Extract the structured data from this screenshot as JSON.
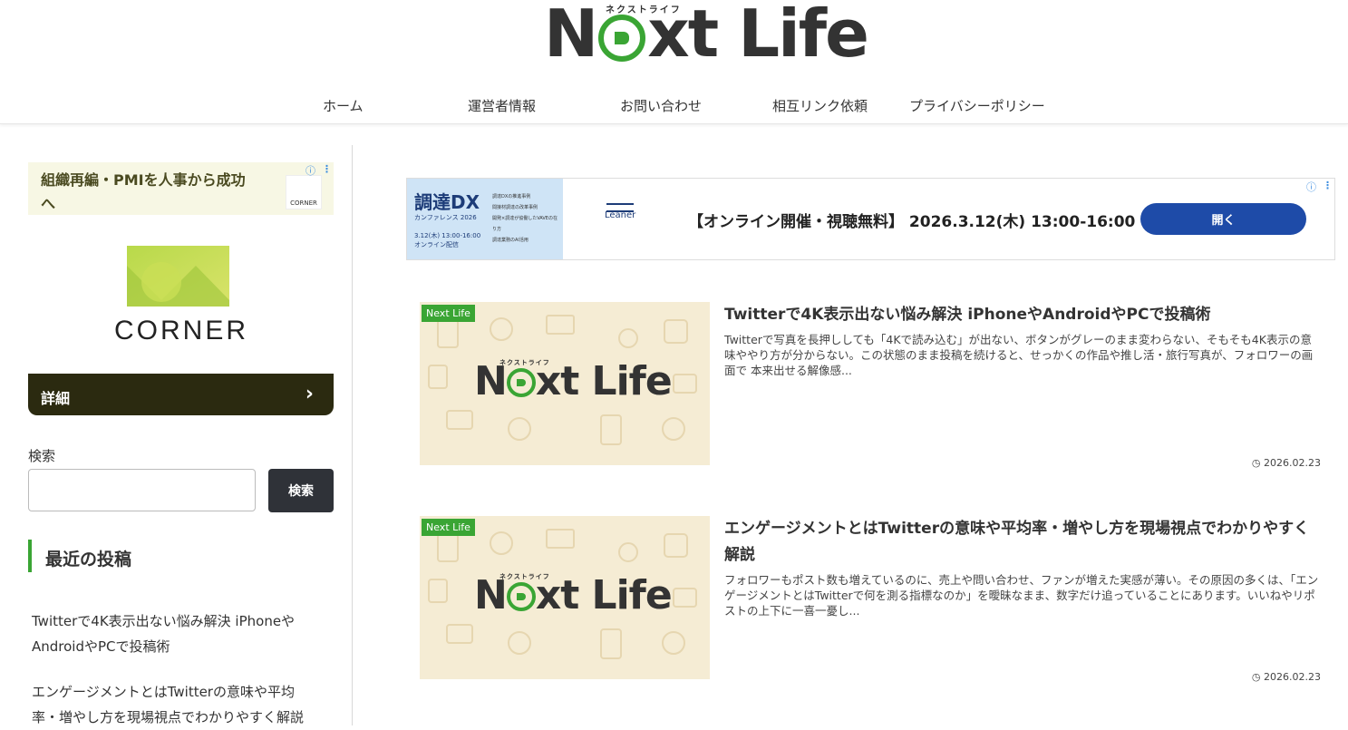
{
  "header": {
    "logo_text_a": "N",
    "logo_text_b": "xt Life",
    "logo_kana": "ネクストライフ"
  },
  "nav": {
    "items": [
      "ホーム",
      "運営者情報",
      "お問い合わせ",
      "相互リンク依頼",
      "プライバシーポリシー"
    ]
  },
  "sidebar": {
    "ad": {
      "headline": "組織再編・PMIを人事から成功へ",
      "logo_label": "CORNER",
      "brand": "CORNER",
      "detail_label": "詳細",
      "detail_chevron": "›"
    },
    "search": {
      "label": "検索",
      "value": "",
      "button_label": "検索"
    },
    "recent": {
      "heading": "最近の投稿",
      "items": [
        "Twitterで4K表示出ない悩み解決 iPhoneやAndroidやPCで投稿術",
        "エンゲージメントとはTwitterの意味や平均率・増やし方を現場視点でわかりやすく解説"
      ]
    }
  },
  "banner_ad": {
    "image_title": "調達DX",
    "image_sub": "カンファレンス 2026",
    "image_date": "3.12(木) 13:00-16:00",
    "image_mode": "オンライン配信",
    "image_list": [
      "調達DXの推進事例",
      "間接材調達の改革事例",
      "開発×調達が協働したVAVEの在り方",
      "調達業務のAI活用"
    ],
    "brand": "Leaner",
    "text": "【オンライン開催・視聴無料】 2026.3.12(木) 13:00-16:00",
    "button_label": "開く"
  },
  "posts": [
    {
      "badge": "Next Life",
      "thumb_kana": "ネクストライフ",
      "thumb_logo_a": "N",
      "thumb_logo_b": "xt Life",
      "title": "Twitterで4K表示出ない悩み解決 iPhoneやAndroidやPCで投稿術",
      "excerpt": "Twitterで写真を長押ししても「4Kで読み込む」が出ない、ボタンがグレーのまま変わらない、そもそも4K表示の意味ややり方が分からない。この状態のまま投稿を続けると、せっかくの作品や推し活・旅行写真が、フォロワーの画面で 本来出せる解像感...",
      "date": "2026.02.23"
    },
    {
      "badge": "Next Life",
      "thumb_kana": "ネクストライフ",
      "thumb_logo_a": "N",
      "thumb_logo_b": "xt Life",
      "title": "エンゲージメントとはTwitterの意味や平均率・増やし方を現場視点でわかりやすく解説",
      "excerpt": "フォロワーもポスト数も増えているのに、売上や問い合わせ、ファンが増えた実感が薄い。その原因の多くは、「エンゲージメントとはTwitterで何を測る指標なのか」を曖昧なまま、数字だけ追っていることにあります。いいねやリポストの上下に一喜一憂し...",
      "date": "2026.02.23"
    }
  ],
  "colors": {
    "accent": "#3aa534",
    "detail_button": "#2b2a10",
    "search_button": "#2f3238",
    "ad_button": "#1e4ba8"
  }
}
